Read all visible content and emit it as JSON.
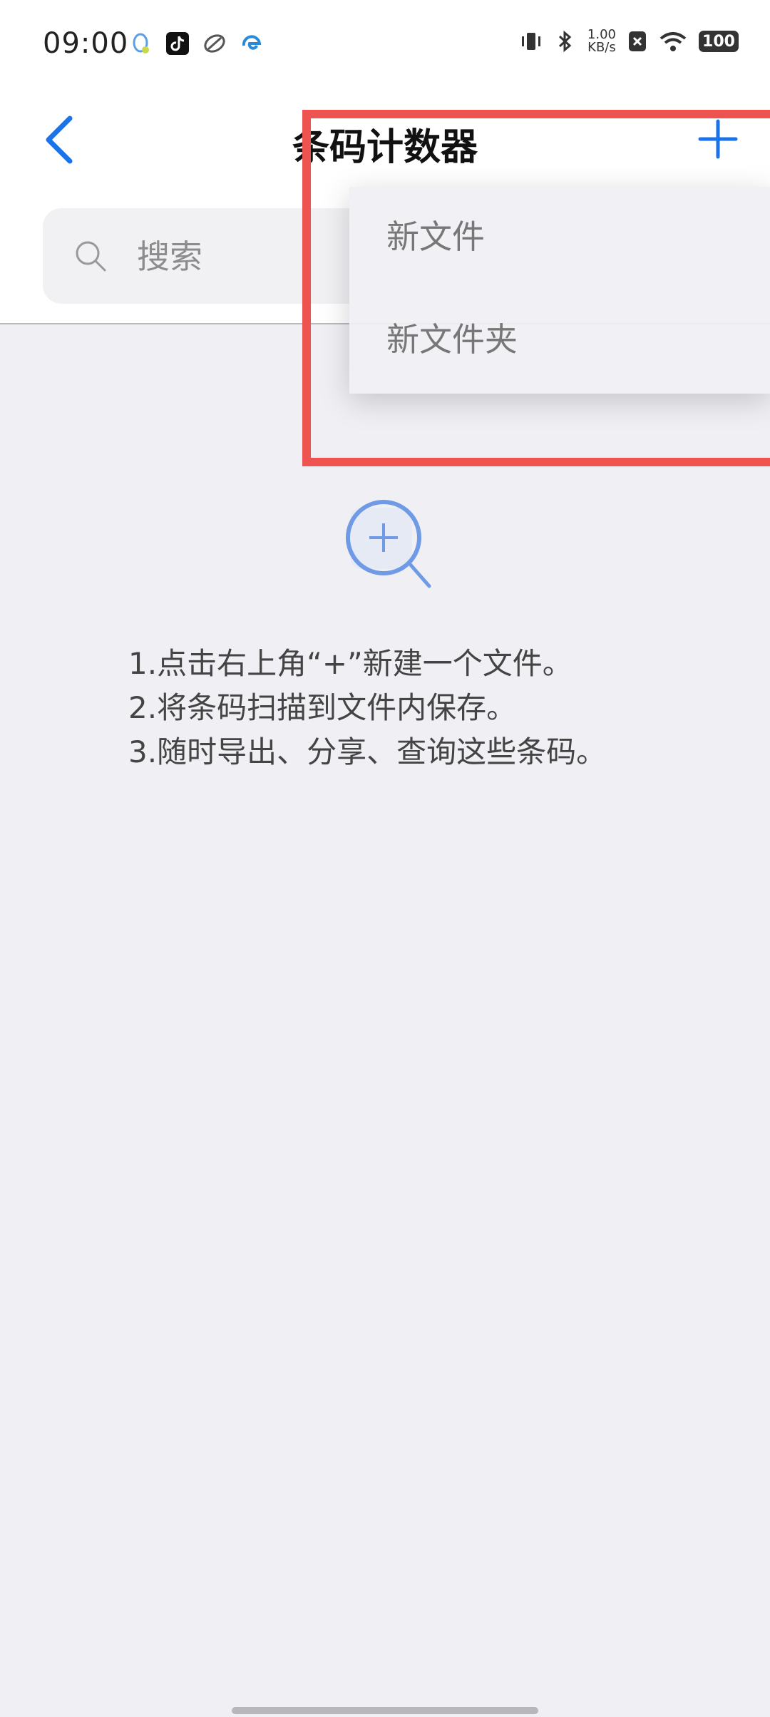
{
  "status_bar": {
    "time": "09:00",
    "speed_value": "1.00",
    "speed_unit": "KB/s",
    "battery": "100"
  },
  "header": {
    "title": "条码计数器"
  },
  "search": {
    "placeholder": "搜索"
  },
  "dropdown": {
    "items": [
      "新文件",
      "新文件夹"
    ]
  },
  "empty_state": {
    "lines": [
      "1.点击右上角“+”新建一个文件。",
      "2.将条码扫描到文件内保存。",
      "3.随时导出、分享、查询这些条码。"
    ]
  },
  "colors": {
    "accent": "#1a73e8",
    "highlight": "#ef5350",
    "background": "#efeff4"
  }
}
